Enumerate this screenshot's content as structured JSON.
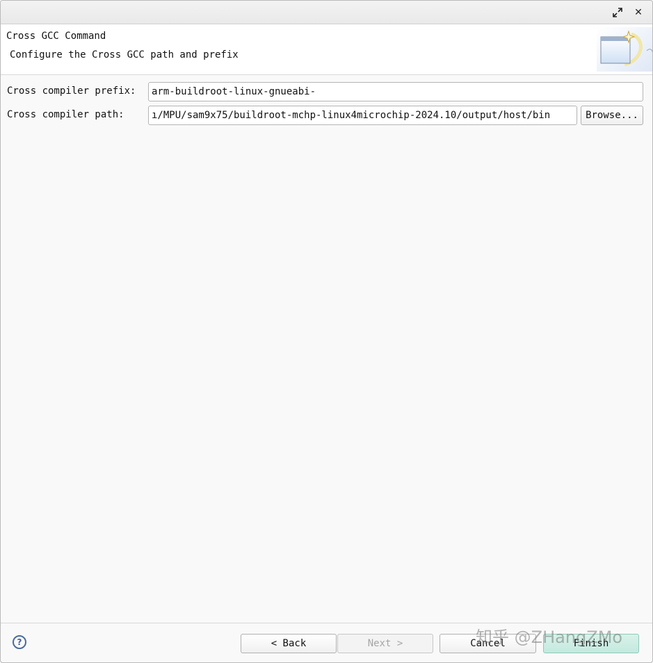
{
  "window": {
    "maximize_icon": "maximize-icon",
    "close_icon": "close-icon",
    "close_glyph": "✕"
  },
  "header": {
    "title": "Cross GCC Command",
    "description": "Configure the Cross GCC path and prefix",
    "banner_icon": "wizard-window-icon"
  },
  "form": {
    "prefix_label": "Cross compiler prefix:",
    "prefix_value": "arm-buildroot-linux-gnueabi-",
    "path_label": "Cross compiler path:",
    "path_value": "ı/MPU/sam9x75/buildroot-mchp-linux4microchip-2024.10/output/host/bin",
    "browse_label": "Browse..."
  },
  "footer": {
    "help_icon": "help-icon",
    "help_glyph": "?",
    "back_label": "< Back",
    "next_label": "Next >",
    "cancel_label": "Cancel",
    "finish_label": "Finish"
  },
  "watermark": {
    "text": "知乎 @ZHangZMo"
  },
  "colors": {
    "finish_accent": "#c4e9de",
    "help_blue": "#4a6c9a"
  }
}
